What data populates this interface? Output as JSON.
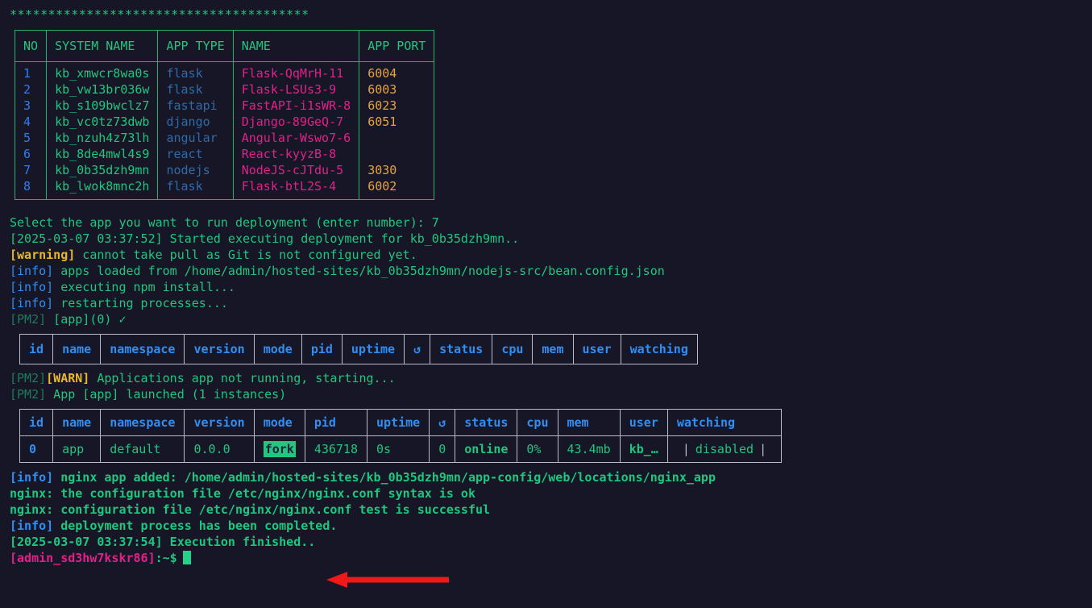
{
  "theme": {
    "background": "#161627",
    "green": "#21c67e",
    "green_dim": "#1f7a5a",
    "blue": "#2f8ff5",
    "steel_blue": "#2f6ba8",
    "pink": "#e0218a",
    "orange": "#e8a33d",
    "yellow": "#e8b828",
    "gray": "#b9bcc7",
    "arrow_red": "#f01818",
    "apps_table_border": "#23b368",
    "pm2_table_border": "#b9bcc7"
  },
  "banner": "***************************************",
  "apps_table": {
    "columns": [
      "NO",
      "SYSTEM NAME",
      "APP TYPE",
      "NAME",
      "APP PORT"
    ],
    "rows": [
      {
        "no": "1",
        "system_name": "kb_xmwcr8wa0s",
        "app_type": "flask",
        "name": "Flask-QqMrH-11",
        "app_port": "6004"
      },
      {
        "no": "2",
        "system_name": "kb_vw13br036w",
        "app_type": "flask",
        "name": "Flask-LSUs3-9",
        "app_port": "6003"
      },
      {
        "no": "3",
        "system_name": "kb_s109bwclz7",
        "app_type": "fastapi",
        "name": "FastAPI-i1sWR-8",
        "app_port": "6023"
      },
      {
        "no": "4",
        "system_name": "kb_vc0tz73dwb",
        "app_type": "django",
        "name": "Django-89GeQ-7",
        "app_port": "6051"
      },
      {
        "no": "5",
        "system_name": "kb_nzuh4z73lh",
        "app_type": "angular",
        "name": "Angular-Wswo7-6",
        "app_port": ""
      },
      {
        "no": "6",
        "system_name": "kb_8de4mwl4s9",
        "app_type": "react",
        "name": "React-kyyzB-8",
        "app_port": ""
      },
      {
        "no": "7",
        "system_name": "kb_0b35dzh9mn",
        "app_type": "nodejs",
        "name": "NodeJS-cJTdu-5",
        "app_port": "3030"
      },
      {
        "no": "8",
        "system_name": "kb_lwok8mnc2h",
        "app_type": "flask",
        "name": "Flask-btL2S-4",
        "app_port": "6002"
      }
    ]
  },
  "prompt_line": {
    "question": "Select the app you want to run deployment (enter number): ",
    "answer": "7"
  },
  "log_top": {
    "line_started_ts": "[2025-03-07 03:37:52]",
    "line_started_text": " Started executing deployment for kb_0b35dzh9mn..",
    "warning_tag": "[warning]",
    "warning_text": " cannot take pull as Git is not configured yet.",
    "info_tag": "[info]",
    "info_apps_loaded": " apps loaded from /home/admin/hosted-sites/kb_0b35dzh9mn/nodejs-src/bean.config.json",
    "info_npm_install": " executing npm install...",
    "info_restarting": " restarting processes...",
    "pm2_tag": "[PM2]",
    "pm2_app_ok": " [app](0) ✓"
  },
  "pm2_table_empty": {
    "columns": [
      "id",
      "name",
      "namespace",
      "version",
      "mode",
      "pid",
      "uptime",
      "↺",
      "status",
      "cpu",
      "mem",
      "user",
      "watching"
    ],
    "rows": []
  },
  "log_middle": {
    "pm2_tag": "[PM2]",
    "warn_tag": "[WARN]",
    "warn_text": " Applications app not running, starting...",
    "launched_text": " App [app] launched (1 instances)"
  },
  "pm2_table_filled": {
    "columns": [
      "id",
      "name",
      "namespace",
      "version",
      "mode",
      "pid",
      "uptime",
      "↺",
      "status",
      "cpu",
      "mem",
      "user",
      "watching"
    ],
    "row": {
      "id": "0",
      "name": "app",
      "namespace": "default",
      "version": "0.0.0",
      "mode": "fork",
      "pid": "436718",
      "uptime": "0s",
      "restarts": "0",
      "status": "online",
      "cpu": "0%",
      "mem": "43.4mb",
      "user": "kb_…",
      "watching": "disabled"
    }
  },
  "log_bottom": {
    "info_tag": "[info]",
    "nginx_added": " nginx app added: /home/admin/hosted-sites/kb_0b35dzh9mn/app-config/web/locations/nginx_app",
    "nginx_syntax": "nginx: the configuration file /etc/nginx/nginx.conf syntax is ok",
    "nginx_test": "nginx: configuration file /etc/nginx/nginx.conf test is successful",
    "deployment_completed": " deployment process has been completed.",
    "finished_ts": "[2025-03-07 03:37:54]",
    "finished_text": " Execution finished.."
  },
  "shell_prompt": {
    "user": "[admin_sd3hw7kskr86]",
    "suffix": ":~$"
  },
  "annotation": {
    "arrow": "left-arrow-annotation",
    "color": "#f01818"
  }
}
